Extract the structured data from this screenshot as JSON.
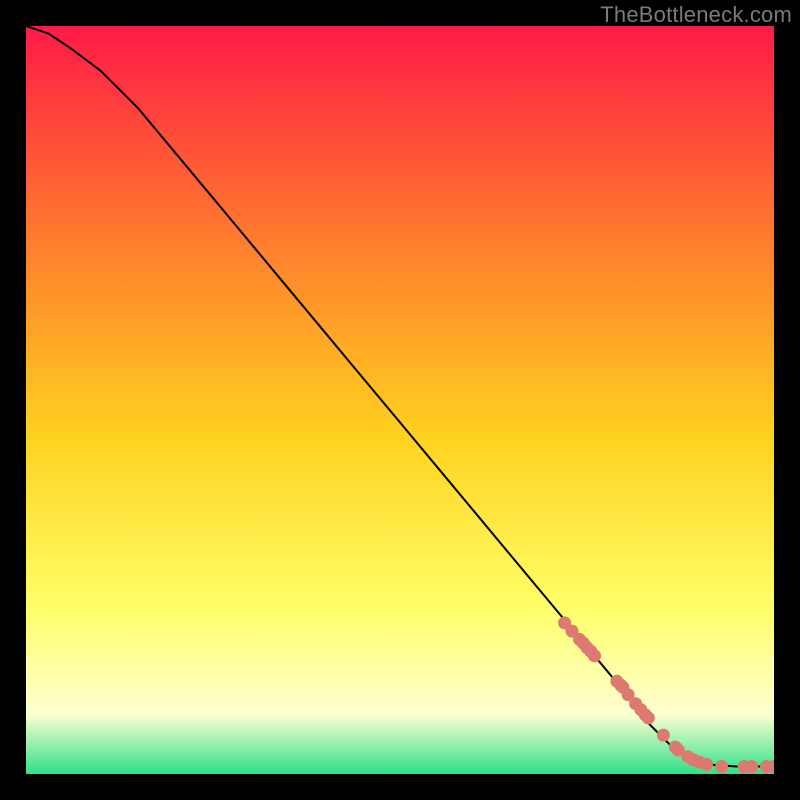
{
  "watermark": "TheBottleneck.com",
  "colors": {
    "gradient_top": "#ff1a46",
    "gradient_upper_mid": "#ff7a2e",
    "gradient_mid": "#ffd21f",
    "gradient_lower_mid": "#ffff6a",
    "gradient_lower": "#fdffd0",
    "gradient_bottom": "#2fe08a",
    "curve": "#000000",
    "points": "#dc7a70",
    "frame_border": "#000000"
  },
  "chart_data": {
    "type": "line",
    "title": "",
    "xlabel": "",
    "ylabel": "",
    "xlim": [
      0,
      100
    ],
    "ylim": [
      0,
      100
    ],
    "series": [
      {
        "name": "bottleneck-curve",
        "x": [
          0,
          3,
          6,
          10,
          15,
          20,
          25,
          30,
          35,
          40,
          45,
          50,
          55,
          60,
          65,
          70,
          75,
          80,
          83,
          86,
          89,
          92,
          95,
          98,
          100
        ],
        "y": [
          100,
          99,
          97,
          94,
          89,
          83,
          77,
          71,
          65,
          59,
          53,
          47,
          41,
          35,
          29,
          23,
          17,
          11,
          7,
          4,
          2,
          1.2,
          1.0,
          1.0,
          1.0
        ]
      }
    ],
    "points": {
      "name": "sample-points",
      "x": [
        72,
        73,
        74,
        74.5,
        75,
        75.5,
        76,
        79,
        79.5,
        79.8,
        80.5,
        81.5,
        82.2,
        82.8,
        83.2,
        85.2,
        86.8,
        87,
        87.2,
        88.5,
        89.2,
        90,
        91,
        93,
        96,
        97,
        99,
        100
      ],
      "y": [
        20.2,
        19.1,
        18.0,
        17.5,
        16.9,
        16.4,
        15.8,
        12.4,
        11.9,
        11.6,
        10.6,
        9.4,
        8.6,
        7.9,
        7.5,
        5.2,
        3.6,
        3.4,
        3.2,
        2.3,
        1.9,
        1.6,
        1.3,
        1.0,
        1.0,
        1.0,
        1.0,
        1.0
      ]
    }
  }
}
